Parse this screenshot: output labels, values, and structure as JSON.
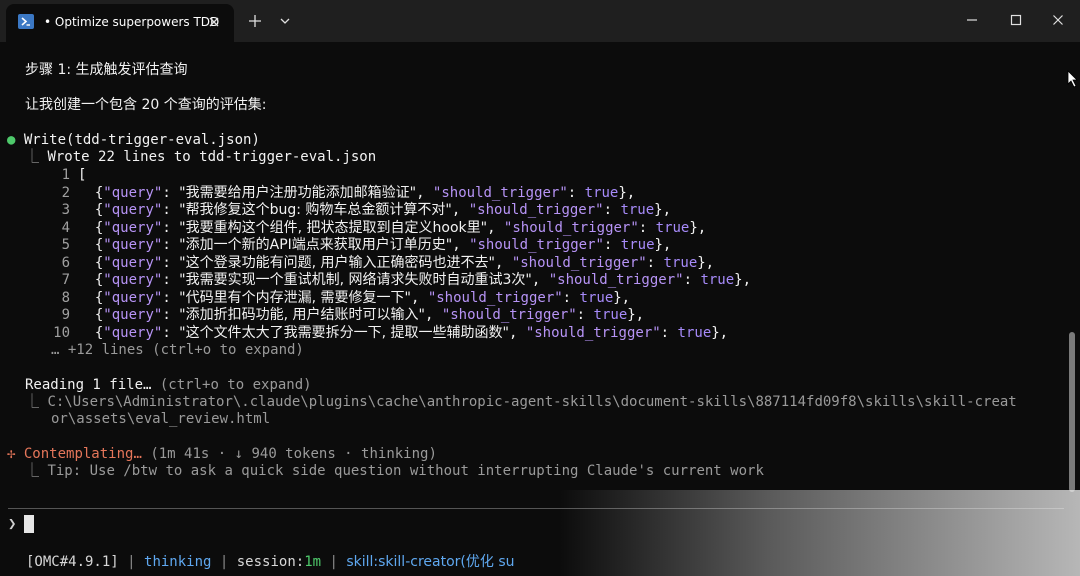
{
  "window": {
    "tab_title": "Optimize superpowers TDD",
    "tab_dot": "•"
  },
  "icons": {
    "tab": "terminal-icon",
    "close": "close-icon",
    "new_tab": "plus-icon",
    "dropdown": "chevron-down-icon",
    "minimize": "minimize-icon",
    "maximize": "maximize-icon",
    "window_close": "close-icon"
  },
  "colors": {
    "background": "#0c0c0c",
    "accent_blue": "#5fa8f0",
    "accent_green": "#4ec96b",
    "accent_orange": "#e5765a",
    "json_key": "#b794f6"
  },
  "terminal": {
    "step_heading": "步骤 1: 生成触发评估查询",
    "intro": "让我创建一个包含 20 个查询的评估集:",
    "write_call": "Write(tdd-trigger-eval.json)",
    "wrote_summary": "Wrote 22 lines to tdd-trigger-eval.json",
    "code_lines": [
      {
        "n": "1",
        "text": "["
      },
      {
        "n": "2",
        "query": "我需要给用户注册功能添加邮箱验证"
      },
      {
        "n": "3",
        "query": "帮我修复这个bug: 购物车总金额计算不对"
      },
      {
        "n": "4",
        "query": "我要重构这个组件, 把状态提取到自定义hook里"
      },
      {
        "n": "5",
        "query": "添加一个新的API端点来获取用户订单历史"
      },
      {
        "n": "6",
        "query": "这个登录功能有问题, 用户输入正确密码也进不去"
      },
      {
        "n": "7",
        "query": "我需要实现一个重试机制, 网络请求失败时自动重试3次"
      },
      {
        "n": "8",
        "query": "代码里有个内存泄漏, 需要修复一下"
      },
      {
        "n": "9",
        "query": "添加折扣码功能, 用户结账时可以输入"
      },
      {
        "n": "10",
        "query": "这个文件太大了我需要拆分一下, 提取一些辅助函数"
      }
    ],
    "json_key_query": "\"query\"",
    "json_key_trigger": "\"should_trigger\"",
    "json_true": "true",
    "more_lines": "… +12 lines (ctrl+o to expand)",
    "reading": "Reading 1 file…",
    "reading_hint": " (ctrl+o to expand)",
    "path_line1": "C:\\Users\\Administrator\\.claude\\plugins\\cache\\anthropic-agent-skills\\document-skills\\887114fd09f8\\skills\\skill-creat",
    "path_line2": "or\\assets\\eval_review.html",
    "contemplating": "Contemplating…",
    "contemplating_meta": " (1m 41s · ↓ 940 tokens · thinking)",
    "tip": "Tip: Use /btw to ask a quick side question without interrupting Claude's current work",
    "prompt_symbol": "❯"
  },
  "status_bar": {
    "version": "[OMC#4.9.1]",
    "mode": "thinking",
    "session_label": "session:",
    "session_value": "1m",
    "skill": "skill:skill-creator(优化 su"
  }
}
